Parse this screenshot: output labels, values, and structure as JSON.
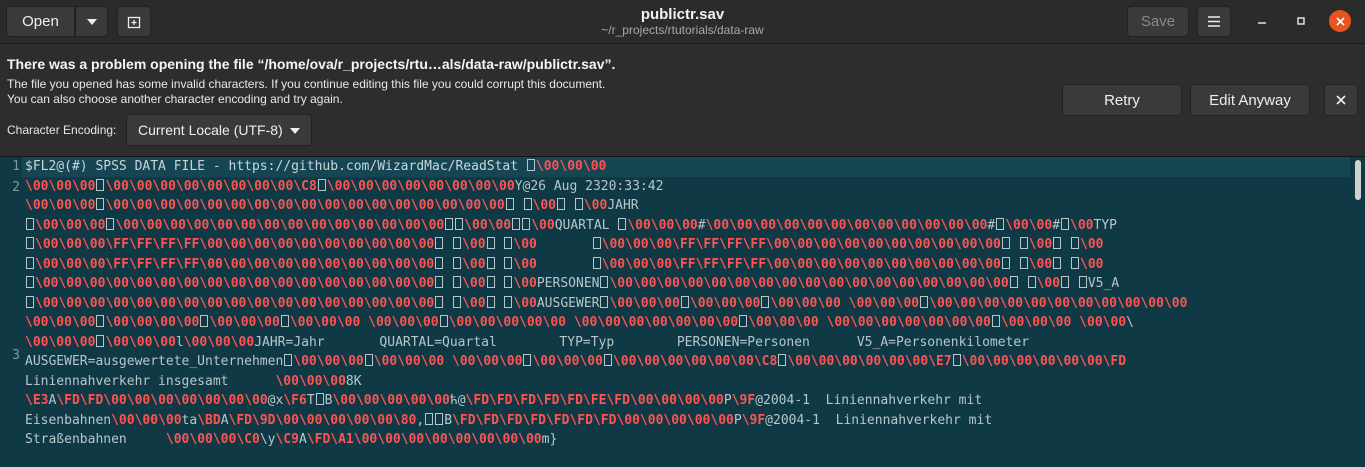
{
  "header": {
    "open_label": "Open",
    "title": "publictr.sav",
    "subtitle": "~/r_projects/rtutorials/data-raw",
    "save_label": "Save",
    "icons": [
      "chevron-down-icon",
      "new-tab-icon",
      "hamburger-menu-icon",
      "minimize-icon",
      "maximize-icon",
      "close-icon"
    ],
    "close_color": "#e95420"
  },
  "infobar": {
    "title": "There was a problem opening the file “/home/ova/r_projects/rtu…als/data-raw/publictr.sav”.",
    "desc_line1": "The file you opened has some invalid characters. If you continue editing this file you could corrupt this document.",
    "desc_line2": "You can also choose another character encoding and try again.",
    "encoding_label": "Character Encoding:",
    "encoding_value": "Current Locale (UTF-8)",
    "retry_label": "Retry",
    "edit_anyway_label": "Edit Anyway"
  },
  "editor": {
    "line_numbers": [
      "1",
      "2",
      "3"
    ],
    "colors": {
      "background": "#0f3a45",
      "text": "#b7c6ca",
      "escape": "#ff5353"
    },
    "lines": [
      "$FL2@(#) SPSS DATA FILE - https://github.com/WizardMac/ReadStat ▯\\00\\00\\00",
      "\\00\\00\\00▯\\00\\00\\00\\00\\00\\00\\00\\00\\C8▯\\00\\00\\00\\00\\00\\00\\00\\00Y@26 Aug 2320:33:42",
      "\\00\\00\\00▯\\00\\00\\00\\00\\00\\00\\00\\00\\00\\00\\00\\00\\00\\00\\00\\00\\00▯ ▯\\00▯ ▯\\00JAHR",
      "▯\\00\\00\\00▯\\00\\00\\00\\00\\00\\00\\00\\00\\00\\00\\00\\00\\00\\00▯▯\\00\\00▯▯\\00QUARTAL ▯\\00\\00\\00#\\00\\00\\00\\00\\00\\00\\00\\00\\00\\00\\00\\00#▯\\00\\00#▯\\00TYP",
      "▯\\00\\00\\00\\FF\\FF\\FF\\FF\\00\\00\\00\\00\\00\\00\\00\\00\\00\\00▯ ▯\\00▯ ▯\\00       ▯\\00\\00\\00\\FF\\FF\\FF\\FF\\00\\00\\00\\00\\00\\00\\00\\00\\00\\00▯ ▯\\00▯ ▯\\00",
      "▯\\00\\00\\00\\FF\\FF\\FF\\FF\\00\\00\\00\\00\\00\\00\\00\\00\\00\\00▯ ▯\\00▯ ▯\\00       ▯\\00\\00\\00\\FF\\FF\\FF\\FF\\00\\00\\00\\00\\00\\00\\00\\00\\00\\00▯ ▯\\00▯ ▯\\00",
      "▯\\00\\00\\00\\00\\00\\00\\00\\00\\00\\00\\00\\00\\00\\00\\00\\00\\00▯ ▯\\00▯ ▯\\00PERSONEN▯\\00\\00\\00\\00\\00\\00\\00\\00\\00\\00\\00\\00\\00\\00\\00\\00\\00▯ ▯\\00▯ ▯V5_A",
      "▯\\00\\00\\00\\00\\00\\00\\00\\00\\00\\00\\00\\00\\00\\00\\00\\00\\00▯ ▯\\00▯ ▯\\00AUSGEWER▯\\00\\00\\00▯\\00\\00\\00▯\\00\\00\\00 \\00\\00\\00▯\\00\\00\\00\\00\\00\\00\\00\\00\\00\\00\\00",
      "\\00\\00\\00▯\\00\\00\\00\\00▯\\00\\00\\00▯\\00\\00\\00 \\00\\00\\00▯\\00\\00\\00\\00\\00 \\00\\00\\00\\00\\00\\00\\00▯\\00\\00\\00 \\00\\00\\00\\00\\00\\00\\00▯\\00\\00\\00 \\00\\00\\",
      "\\00\\00\\00▯\\00\\00\\00l\\00\\00\\00JAHR=Jahr       QUARTAL=Quartal        TYP=Typ        PERSONEN=Personen      V5_A=Personenkilometer",
      "AUSGEWER=ausgewertete_Unternehmen▯\\00\\00\\00▯\\00\\00\\00 \\00\\00\\00▯\\00\\00\\00▯\\00\\00\\00\\00\\00\\00\\C8▯\\00\\00\\00\\00\\00\\00\\E7▯\\00\\00\\00\\00\\00\\00\\FD",
      "Liniennahverkehr insgesamt      \\00\\00\\008K",
      "\\E3A\\FD\\FD\\00\\00\\00\\00\\00\\00\\00@x\\F6T▯B\\00\\00\\00\\00\\00ћ@\\FD\\FD\\FD\\FD\\FD\\FE\\FD\\00\\00\\00\\00P\\9F@2004-1  Liniennahverkehr mit",
      "Eisenbahnen\\00\\00\\00ta\\BDA\\FD\\9D\\00\\00\\00\\00\\00\\80,▯▯B\\FD\\FD\\FD\\FD\\FD\\FD\\FD\\00\\00\\00\\00\\00P\\9F@2004-1  Liniennahverkehr mit",
      "Straßenbahnen     \\00\\00\\00\\C0\\y\\C9A\\FD\\A1\\00\\00\\00\\00\\00\\00\\00\\00m}"
    ]
  }
}
